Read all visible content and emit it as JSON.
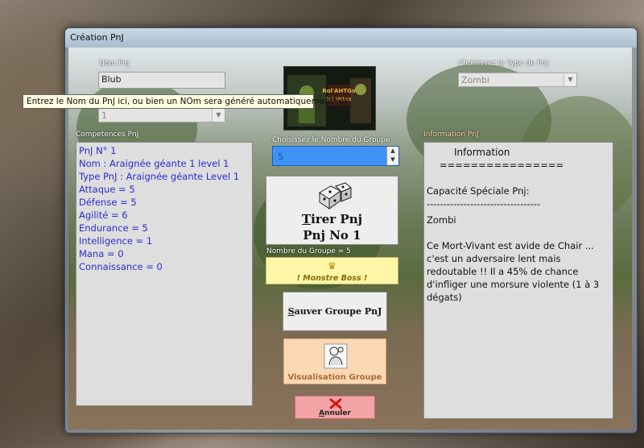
{
  "window": {
    "title": "Création PnJ"
  },
  "labels": {
    "nom_pnj": "Nom Pnj",
    "type_pnj": "Choisissez le Type de PnJ",
    "competences": "Competences PnJ",
    "nombre_groupe": "Choisissez le Nombre du Groupe",
    "information": "Information PnJ",
    "nombre_du_groupe": "Nombre du Groupe = 5"
  },
  "fields": {
    "nom_value": "Blub",
    "level_value": "1",
    "type_value": "Zombi",
    "group_count": "5"
  },
  "tooltip": "Entrez le Nom du PnJ ici, ou bien un NOm sera généré automatiquement ;o)",
  "logo": {
    "line1": "Rol'AHTGo",
    "line2": "(c) Vetea"
  },
  "competences": [
    "PnJ N° 1",
    "Nom : Araignée géante 1 level 1",
    "Type PnJ : Araignée géante Level 1",
    "Attaque = 5",
    "Défense = 5",
    "Agilité = 6",
    "Endurance = 5",
    "Intelligence = 1",
    "Mana = 0",
    "Connaissance = 0"
  ],
  "information": {
    "heading": "Information",
    "separator": "================",
    "capacite_label": "Capacité Spéciale Pnj:",
    "dashes": "----------------------------------",
    "type": "Zombi",
    "description": "Ce Mort-Vivant est avide de Chair ... c'est un adversaire lent mais redoutable !! Il a 45% de chance d'infliger une morsure violente (1 à 3 dégats)"
  },
  "buttons": {
    "tirer_line1": "Tirer Pnj",
    "tirer_line2": "Pnj No  1",
    "boss": "! Monstre Boss !",
    "sauver": "Sauver Groupe PnJ",
    "visualisation": "Visualisation Groupe",
    "annuler": "Annuler"
  },
  "icons": {
    "tirer": "dice-icon",
    "boss": "crown-icon",
    "visualisation": "character-icon",
    "annuler": "red-x-icon",
    "spinner_up": "chevron-up-icon",
    "spinner_down": "chevron-down-icon"
  },
  "colors": {
    "competence_text": "#2b2bd0",
    "spinner_bg": "#3e92f4",
    "boss_bg": "#fff6a8",
    "visualisation_bg": "#fad8b4",
    "annuler_bg": "#f2a4a6"
  }
}
